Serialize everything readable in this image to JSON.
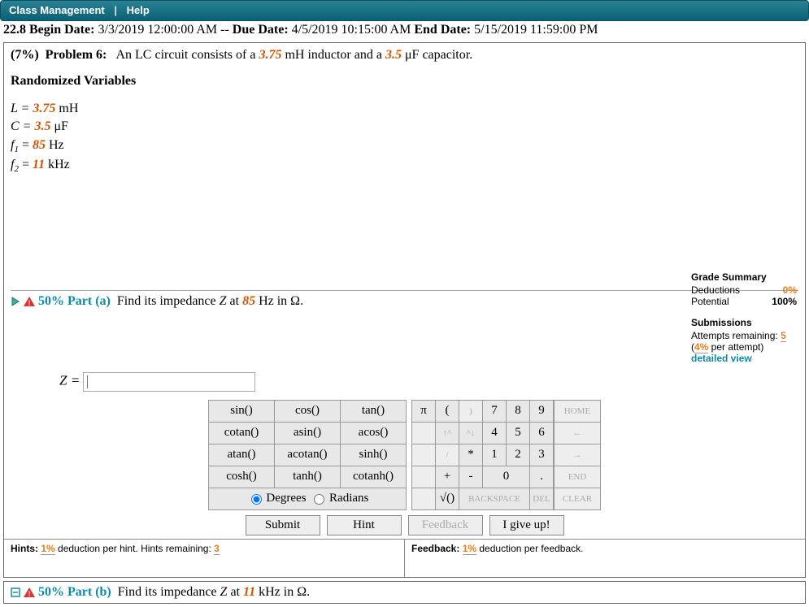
{
  "topbar": {
    "class_mgmt": "Class Management",
    "help": "Help"
  },
  "dates": {
    "begin_label": "22.8 Begin Date:",
    "begin": "3/3/2019 12:00:00 AM",
    "sep": "--",
    "due_label": "Due Date:",
    "due": "4/5/2019 10:15:00 AM",
    "end_label": "End Date:",
    "end": "5/15/2019 11:59:00 PM"
  },
  "problem": {
    "weight": "(7%)",
    "label": "Problem 6:",
    "text_a": "An LC circuit consists of a",
    "L_val": "3.75",
    "L_unit": "mH inductor and a",
    "C_val": "3.5",
    "C_unit": "μF capacitor."
  },
  "rand_title": "Randomized Variables",
  "vars": {
    "L_lhs": "L =",
    "L_val": "3.75",
    "L_unit": " mH",
    "C_lhs": "C =",
    "C_val": "3.5",
    "C_unit": " μF",
    "f1_lhs_a": "f",
    "f1_lhs_b": "1",
    "f1_eq": " =",
    "f1_val": "85",
    "f1_unit": " Hz",
    "f2_lhs_a": "f",
    "f2_lhs_b": "2",
    "f2_eq": " =",
    "f2_val": "11",
    "f2_unit": " kHz"
  },
  "part_a": {
    "pct": "50% Part (a)",
    "text_a": "Find its impedance",
    "Z": "Z",
    "text_b": "at",
    "freq": "85",
    "text_c": "Hz in Ω.",
    "answer_label": "Z ="
  },
  "grade": {
    "title": "Grade Summary",
    "ded_label": "Deductions",
    "ded_val": "0%",
    "pot_label": "Potential",
    "pot_val": "100%",
    "sub_title": "Submissions",
    "att_label": "Attempts remaining:",
    "att_val": "5",
    "per_a": "(",
    "per_val": "4%",
    "per_b": " per attempt)",
    "detailed": "detailed view"
  },
  "kbd": {
    "f": [
      [
        "sin()",
        "cos()",
        "tan()"
      ],
      [
        "cotan()",
        "asin()",
        "acos()"
      ],
      [
        "atan()",
        "acotan()",
        "sinh()"
      ],
      [
        "cosh()",
        "tanh()",
        "cotanh()"
      ]
    ],
    "angle_deg": "Degrees",
    "angle_rad": "Radians",
    "sym": [
      [
        "π",
        "(",
        ")",
        "7",
        "8",
        "9"
      ],
      [
        "",
        "↑^",
        "^↓",
        "4",
        "5",
        "6"
      ],
      [
        "",
        "/",
        "*",
        "1",
        "2",
        "3"
      ],
      [
        "",
        "+",
        "-",
        "0",
        "",
        ". "
      ],
      [
        "",
        "√()",
        "",
        "",
        "",
        ""
      ]
    ],
    "ctrl": [
      "HOME",
      "←",
      "→",
      "END",
      "CLEAR"
    ],
    "backspace": "BACKSPACE",
    "del": "DEL"
  },
  "buttons": {
    "submit": "Submit",
    "hint": "Hint",
    "feedback": "Feedback",
    "giveup": "I give up!"
  },
  "hints": {
    "hints_a": "Hints:",
    "hints_pct": "1%",
    "hints_b": " deduction per hint. Hints remaining: ",
    "hints_rem": "3",
    "fb_a": "Feedback:",
    "fb_pct": "1%",
    "fb_b": " deduction per feedback."
  },
  "part_b": {
    "pct": "50% Part (b)",
    "text_a": "Find its impedance",
    "Z": "Z",
    "text_b": "at",
    "freq": "11",
    "text_c": "kHz in Ω."
  }
}
